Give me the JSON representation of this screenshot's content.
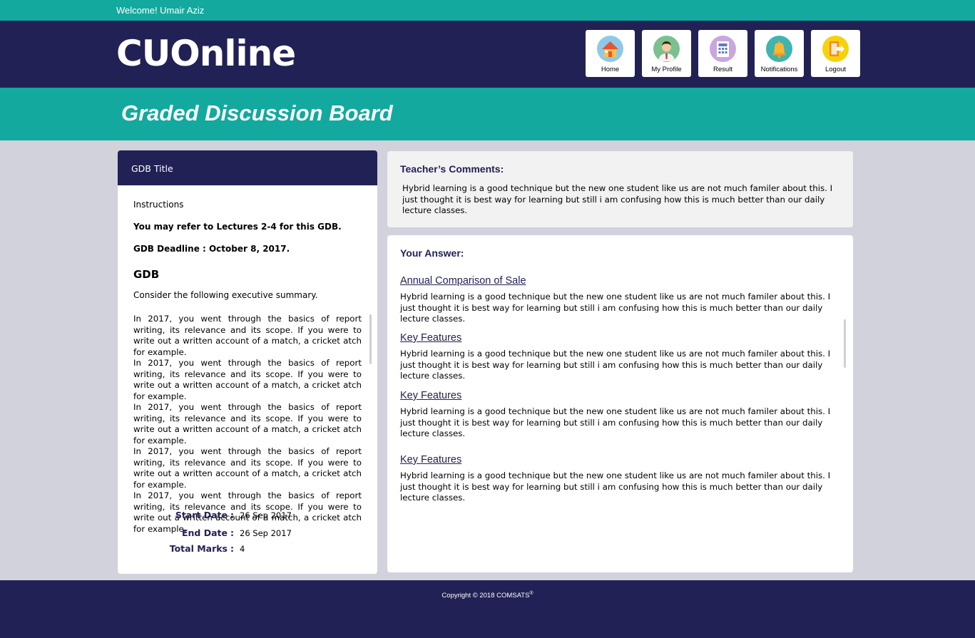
{
  "topbar": {
    "welcome": "Welcome! Umair Aziz"
  },
  "header": {
    "logo": "CUOnline",
    "nav": [
      {
        "label": "Home",
        "icon": "home-icon"
      },
      {
        "label": "My Profile",
        "icon": "profile-icon"
      },
      {
        "label": "Result",
        "icon": "result-icon"
      },
      {
        "label": "Notifications",
        "icon": "bell-icon"
      },
      {
        "label": "Logout",
        "icon": "logout-icon"
      }
    ]
  },
  "page": {
    "title": "Graded Discussion Board"
  },
  "gdb": {
    "header": "GDB Title",
    "instructions_label": "Instructions",
    "refer": "You may refer to Lectures 2-4 for this GDB.",
    "deadline": "GDB Deadline : October 8, 2017.",
    "heading": "GDB",
    "consider": "Consider the following executive summary.",
    "summary": [
      "In 2017,  you went through the basics of report writing, its relevance and its scope. If you were to write out a written account of a match, a cricket atch for example.",
      "In 2017,  you went through the basics of report writing, its relevance and its scope. If you were to write out a written account of a match, a cricket atch for example.",
      "In 2017,  you went through the basics of report writing, its relevance and its scope. If you were to write out a written account of a match, a cricket atch for example.",
      "In 2017,  you went through the basics of report writing, its relevance and its scope. If you were to write out a written account of a match, a cricket atch for example.",
      "In 2017,  you went through the basics of report writing, its relevance and its scope. If you were to write out a written account of a match, a cricket atch for example."
    ],
    "meta": {
      "start_label": "Start Date",
      "start_value": "26 Sep 2017",
      "end_label": "End Date",
      "end_value": "26 Sep 2017",
      "marks_label": "Total Marks",
      "marks_value": "4",
      "colon": ":"
    }
  },
  "comments": {
    "heading": "Teacher’s Comments:",
    "text": "Hybrid learning is a good technique but the new one student like us are not much familer about this. I just thought it is best way for learning but still i am confusing how this is much better than our daily lecture classes."
  },
  "answer": {
    "heading": "Your Answer:",
    "sections": [
      {
        "title": "Annual Comparison of Sale",
        "text": "Hybrid learning is a good technique but the new one student like us are not much familer about this. I just thought it is best way for learning but still i am confusing how this is much better than our daily lecture classes."
      },
      {
        "title": "Key Features",
        "text": "Hybrid learning is a good technique but the new one student like us are not much familer about this. I just thought it is best way for learning but still i am confusing how this is much better than our daily lecture classes."
      },
      {
        "title": "Key Features",
        "text": "Hybrid learning is a good technique but the new one student like us are not much familer about this. I just thought it is best way for learning but still i am confusing how this is much better than our daily lecture classes."
      },
      {
        "title": "Key Features",
        "text": "Hybrid learning is a good technique but the new one student like us are not much familer about this. I just thought it is best way for learning but still i am confusing how this is much better than our daily lecture classes."
      }
    ]
  },
  "footer": {
    "copyright": "Copyright © 2018 COMSATS",
    "mark": "®"
  },
  "colors": {
    "navy": "#222155",
    "teal": "#13a99e",
    "background": "#d1d2dc"
  }
}
